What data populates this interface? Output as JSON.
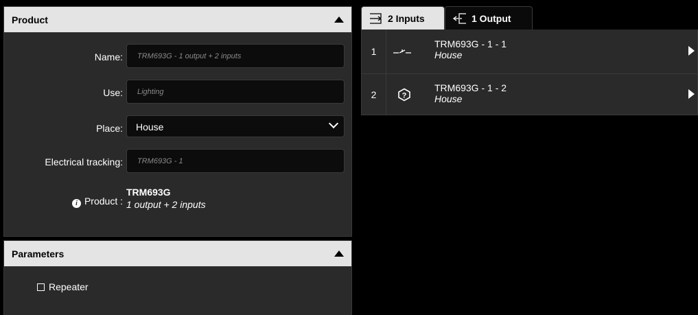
{
  "product_panel": {
    "header": "Product",
    "name_label": "Name:",
    "name_placeholder": "TRM693G - 1 output + 2 inputs",
    "use_label": "Use:",
    "use_placeholder": "Lighting",
    "place_label": "Place:",
    "place_value": "House",
    "tracking_label": "Electrical tracking:",
    "tracking_placeholder": "TRM693G - 1",
    "product_label": "Product :",
    "product_name": "TRM693G",
    "product_desc": "1 output + 2 inputs"
  },
  "params_panel": {
    "header": "Parameters",
    "repeater_label": "Repeater",
    "repeater_checked": false
  },
  "tabs": [
    {
      "label": "2 Inputs",
      "icon": "inputs-icon",
      "active": true
    },
    {
      "label": "1 Output",
      "icon": "output-icon",
      "active": false
    }
  ],
  "inputs": [
    {
      "num": "1",
      "icon": "switch-contact-icon",
      "title": "TRM693G - 1 - 1",
      "place": "House"
    },
    {
      "num": "2",
      "icon": "question-shield-icon",
      "title": "TRM693G - 1 - 2",
      "place": "House"
    }
  ],
  "colors": {
    "panel_bg": "#2a2a2a",
    "header_bg": "#e4e4e4",
    "page_bg": "#000000",
    "field_bg": "#0c0c0c"
  }
}
